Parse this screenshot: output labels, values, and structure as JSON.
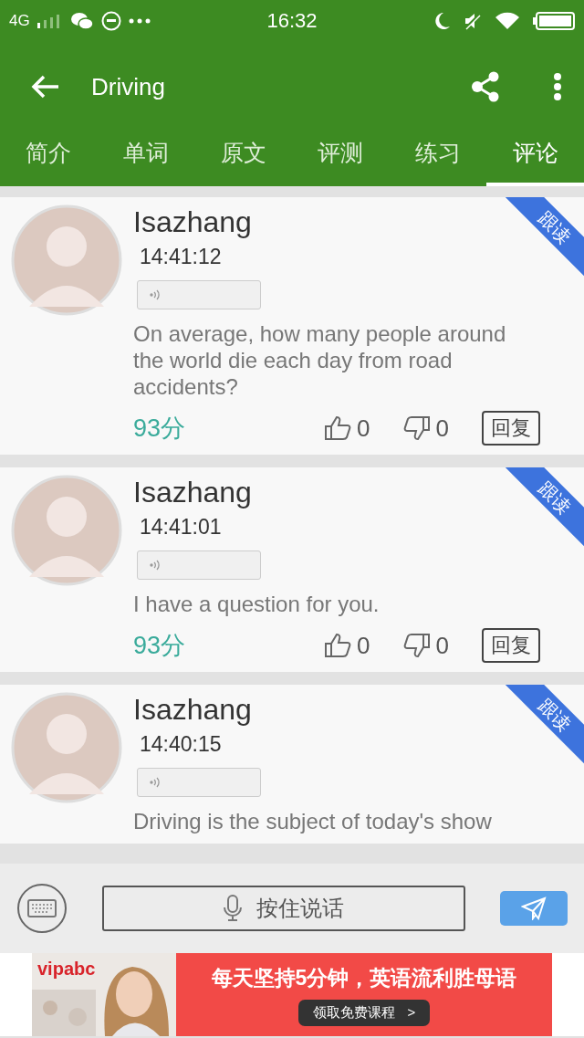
{
  "status_bar": {
    "network": "4G",
    "time": "16:32"
  },
  "toolbar": {
    "title": "Driving"
  },
  "tabs": [
    {
      "label": "简介",
      "selected": false
    },
    {
      "label": "单词",
      "selected": false
    },
    {
      "label": "原文",
      "selected": false
    },
    {
      "label": "评测",
      "selected": false
    },
    {
      "label": "练习",
      "selected": false
    },
    {
      "label": "评论",
      "selected": true
    }
  ],
  "comments": [
    {
      "name": "Isazhang",
      "time": "14:41:12",
      "badge": "跟读",
      "text": "On average, how many people around the world die each day from road accidents?",
      "score": "93分",
      "likes": "0",
      "dislikes": "0",
      "reply": "回复"
    },
    {
      "name": "Isazhang",
      "time": "14:41:01",
      "badge": "跟读",
      "text": "I have a question for you.",
      "score": "93分",
      "likes": "0",
      "dislikes": "0",
      "reply": "回复"
    },
    {
      "name": "Isazhang",
      "time": "14:40:15",
      "badge": "跟读",
      "text": "Driving is the subject of today's show"
    }
  ],
  "input_bar": {
    "hold_to_talk": "按住说话"
  },
  "ad": {
    "brand": "vipabc",
    "headline": "每天坚持5分钟，英语流利胜母语",
    "cta": "领取免费课程",
    "cta_arrow": ">"
  }
}
